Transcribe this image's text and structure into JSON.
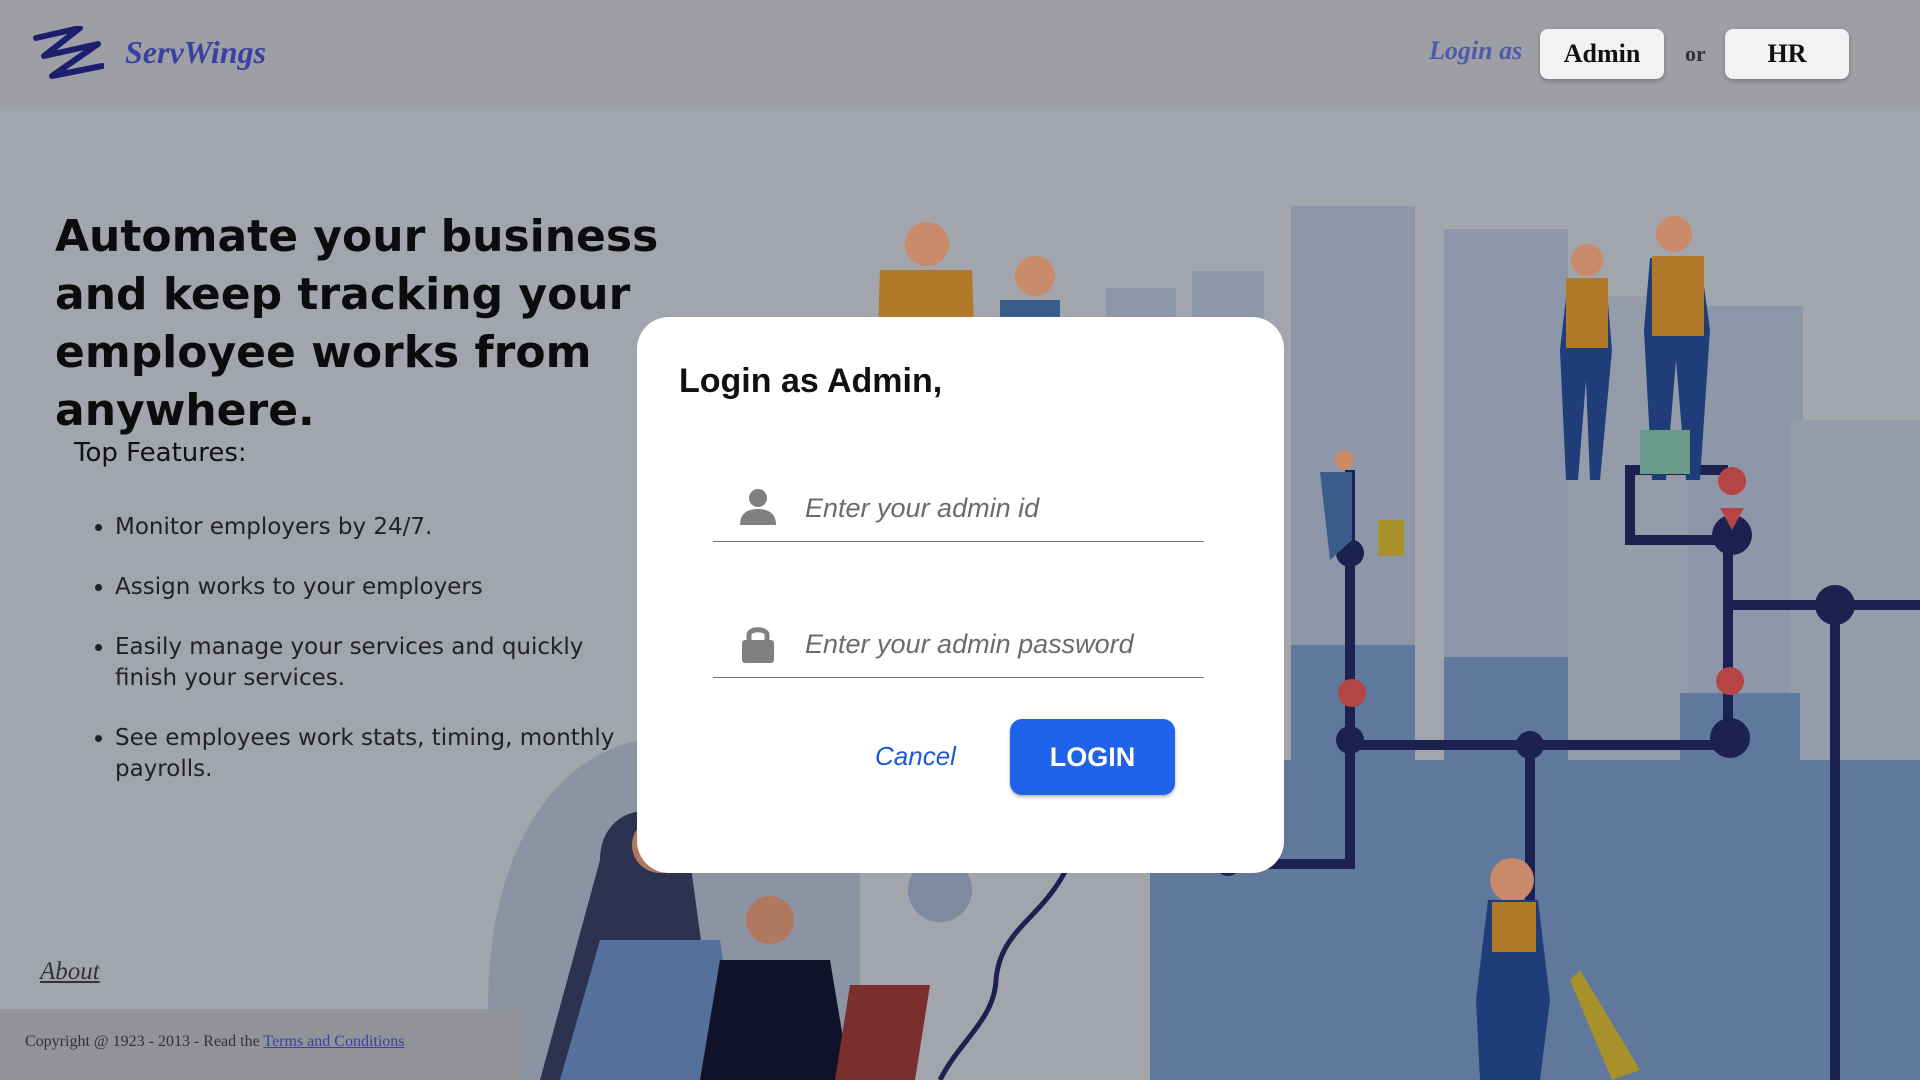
{
  "header": {
    "brand": "ServWings",
    "login_as": "Login as",
    "admin_label": "Admin",
    "or_label": "or",
    "hr_label": "HR"
  },
  "hero": {
    "headline": "Automate your business and keep tracking your employee works from anywhere.",
    "features_title": "Top Features:",
    "features": [
      "Monitor employers by 24/7.",
      "Assign works to your employers",
      "Easily manage your services and quickly finish your services.",
      "See employees work stats, timing, monthly payrolls."
    ]
  },
  "footer": {
    "about": "About",
    "copyright_prefix": "Copyright @ 1923 - 2013 - Read the",
    "terms_link": "Terms and Conditions"
  },
  "modal": {
    "title": "Login as Admin,",
    "id_placeholder": "Enter your admin id",
    "password_placeholder": "Enter your admin password",
    "cancel_label": "Cancel",
    "login_label": "LOGIN"
  },
  "colors": {
    "overlay": "#a2a5ac",
    "brand": "#3a3fa3",
    "login_button": "#1f63ea",
    "cancel_link": "#1a5bd6"
  },
  "icons": {
    "logo": "servwings-logo-icon",
    "user": "user-icon",
    "lock": "lock-icon"
  }
}
